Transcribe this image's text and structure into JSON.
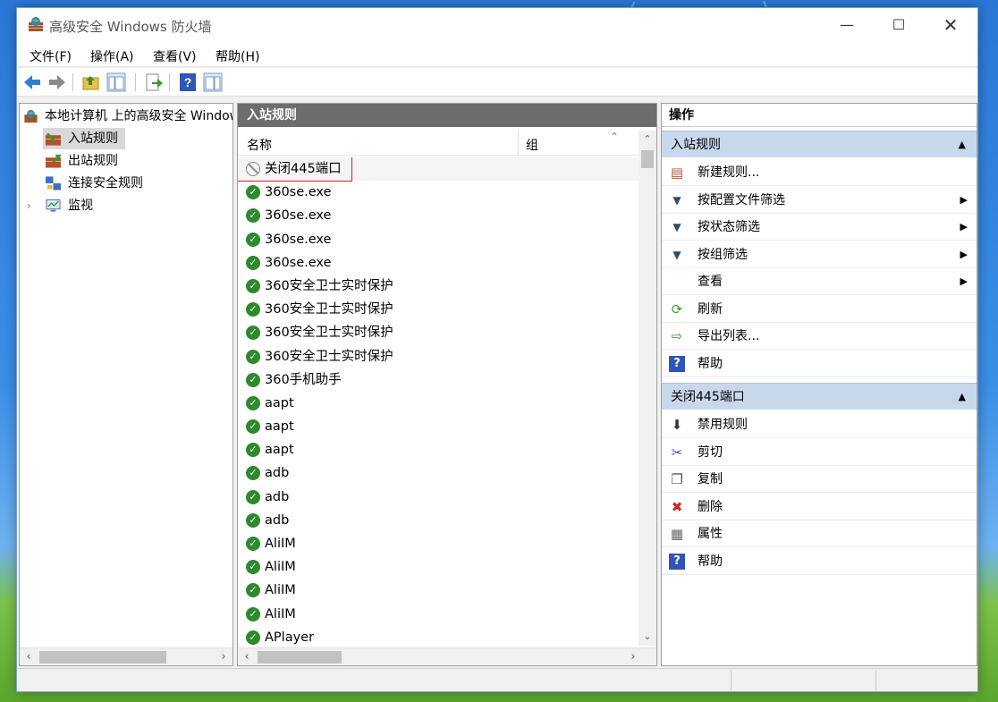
{
  "window": {
    "title": "高级安全 Windows 防火墙"
  },
  "menu": [
    "文件(F)",
    "操作(A)",
    "查看(V)",
    "帮助(H)"
  ],
  "tree": {
    "root": "本地计算机 上的高级安全 Windows",
    "items": [
      "入站规则",
      "出站规则",
      "连接安全规则",
      "监视"
    ]
  },
  "list": {
    "header": "入站规则",
    "columns": {
      "name": "名称",
      "group": "组"
    },
    "rows": [
      {
        "name": "关闭445端口",
        "status": "blocked"
      },
      {
        "name": "360se.exe",
        "status": "allowed"
      },
      {
        "name": "360se.exe",
        "status": "allowed"
      },
      {
        "name": "360se.exe",
        "status": "allowed"
      },
      {
        "name": "360se.exe",
        "status": "allowed"
      },
      {
        "name": "360安全卫士实时保护",
        "status": "allowed"
      },
      {
        "name": "360安全卫士实时保护",
        "status": "allowed"
      },
      {
        "name": "360安全卫士实时保护",
        "status": "allowed"
      },
      {
        "name": "360安全卫士实时保护",
        "status": "allowed"
      },
      {
        "name": "360手机助手",
        "status": "allowed"
      },
      {
        "name": "aapt",
        "status": "allowed"
      },
      {
        "name": "aapt",
        "status": "allowed"
      },
      {
        "name": "aapt",
        "status": "allowed"
      },
      {
        "name": "adb",
        "status": "allowed"
      },
      {
        "name": "adb",
        "status": "allowed"
      },
      {
        "name": "adb",
        "status": "allowed"
      },
      {
        "name": "AliIM",
        "status": "allowed"
      },
      {
        "name": "AliIM",
        "status": "allowed"
      },
      {
        "name": "AliIM",
        "status": "allowed"
      },
      {
        "name": "AliIM",
        "status": "allowed"
      },
      {
        "name": "APlayer",
        "status": "allowed"
      }
    ]
  },
  "actions": {
    "header": "操作",
    "section1": {
      "title": "入站规则",
      "items": [
        {
          "label": "新建规则...",
          "icon": "new-rule-icon"
        },
        {
          "label": "按配置文件筛选",
          "icon": "filter-icon",
          "submenu": true
        },
        {
          "label": "按状态筛选",
          "icon": "filter-icon",
          "submenu": true
        },
        {
          "label": "按组筛选",
          "icon": "filter-icon",
          "submenu": true
        },
        {
          "label": "查看",
          "icon": "",
          "submenu": true
        },
        {
          "label": "刷新",
          "icon": "refresh-icon"
        },
        {
          "label": "导出列表...",
          "icon": "export-icon"
        },
        {
          "label": "帮助",
          "icon": "help-icon"
        }
      ]
    },
    "section2": {
      "title": "关闭445端口",
      "items": [
        {
          "label": "禁用规则",
          "icon": "disable-icon"
        },
        {
          "label": "剪切",
          "icon": "cut-icon"
        },
        {
          "label": "复制",
          "icon": "copy-icon"
        },
        {
          "label": "删除",
          "icon": "delete-icon"
        },
        {
          "label": "属性",
          "icon": "properties-icon"
        },
        {
          "label": "帮助",
          "icon": "help-icon"
        }
      ]
    }
  }
}
